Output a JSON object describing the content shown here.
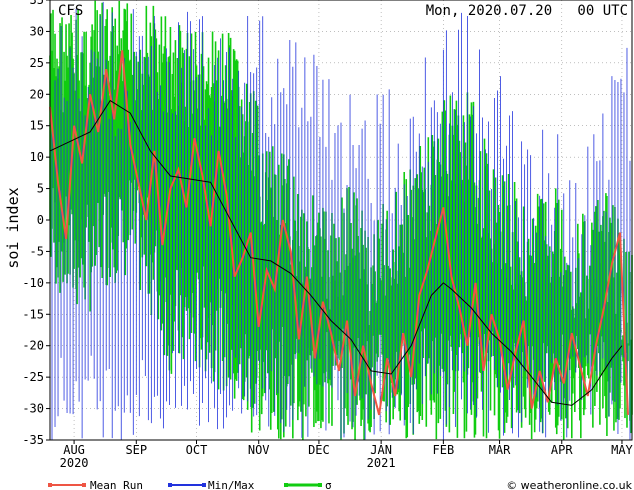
{
  "header": {
    "model": "CFS",
    "datetime": "Mon, 2020.07.20   00 UTC"
  },
  "credit": "© weatheronline.co.uk",
  "chart_data": {
    "type": "line",
    "title": "CFS",
    "ylabel": "soi index",
    "xlabel": "",
    "ylim": [
      -35,
      35
    ],
    "y_ticks": [
      -35,
      -30,
      -25,
      -20,
      -15,
      -10,
      -5,
      0,
      5,
      10,
      15,
      20,
      25,
      30,
      35
    ],
    "x_ticks": [
      {
        "label": "AUG",
        "sublabel": "2020",
        "day": 12
      },
      {
        "label": "SEP",
        "sublabel": "",
        "day": 43
      },
      {
        "label": "OCT",
        "sublabel": "",
        "day": 73
      },
      {
        "label": "NOV",
        "sublabel": "",
        "day": 104
      },
      {
        "label": "DEC",
        "sublabel": "",
        "day": 134
      },
      {
        "label": "JAN",
        "sublabel": "2021",
        "day": 165
      },
      {
        "label": "FEB",
        "sublabel": "",
        "day": 196
      },
      {
        "label": "MAR",
        "sublabel": "",
        "day": 224
      },
      {
        "label": "APR",
        "sublabel": "",
        "day": 255
      },
      {
        "label": "MAY",
        "sublabel": "",
        "day": 285
      }
    ],
    "xlim": [
      0,
      290
    ],
    "grid": true,
    "legend": {
      "placement": "bottom",
      "entries": [
        {
          "name": "Mean Run",
          "color": "#ee5544"
        },
        {
          "name": "Min/Max",
          "color": "#2233dd"
        },
        {
          "name": "σ",
          "color": "#11cc11"
        }
      ]
    },
    "series": [
      {
        "name": "Mean Run",
        "color": "#ee5544",
        "x": [
          0,
          4,
          8,
          12,
          16,
          20,
          24,
          28,
          32,
          36,
          40,
          44,
          48,
          52,
          56,
          60,
          64,
          68,
          72,
          76,
          80,
          84,
          88,
          92,
          96,
          100,
          104,
          108,
          112,
          116,
          120,
          124,
          128,
          132,
          136,
          140,
          144,
          148,
          152,
          156,
          160,
          164,
          168,
          172,
          176,
          180,
          184,
          188,
          192,
          196,
          200,
          204,
          208,
          212,
          216,
          220,
          224,
          228,
          232,
          236,
          240,
          244,
          248,
          252,
          256,
          260,
          264,
          268,
          272,
          276,
          280,
          284,
          288
        ],
        "y": [
          18,
          6,
          -3,
          15,
          9,
          20,
          14,
          24,
          16,
          27,
          12,
          6,
          0,
          11,
          -4,
          5,
          8,
          2,
          13,
          7,
          -1,
          11,
          4,
          -9,
          -6,
          -2,
          -17,
          -8,
          -11,
          0,
          -5,
          -19,
          -9,
          -22,
          -13,
          -18,
          -24,
          -16,
          -28,
          -20,
          -26,
          -31,
          -22,
          -28,
          -18,
          -25,
          -12,
          -8,
          -3,
          2,
          -9,
          -14,
          -20,
          -10,
          -24,
          -15,
          -19,
          -27,
          -21,
          -16,
          -30,
          -24,
          -29,
          -22,
          -26,
          -18,
          -23,
          -28,
          -20,
          -14,
          -7,
          -2,
          -31
        ]
      },
      {
        "name": "",
        "color": "#000000",
        "x": [
          0,
          10,
          20,
          30,
          40,
          50,
          60,
          70,
          80,
          90,
          100,
          110,
          120,
          130,
          140,
          150,
          160,
          170,
          180,
          190,
          196,
          200,
          210,
          220,
          230,
          240,
          250,
          260,
          270,
          280,
          285
        ],
        "y": [
          11,
          12.5,
          14,
          19,
          17,
          11,
          7,
          6.5,
          6,
          0,
          -6,
          -6.5,
          -8.5,
          -12,
          -16,
          -19,
          -24,
          -24.5,
          -20,
          -12,
          -10,
          -11,
          -14,
          -18,
          -21,
          -25,
          -29,
          -29.5,
          -27,
          -22,
          -20
        ]
      }
    ],
    "envelope": {
      "name": "σ",
      "color": "#11cc11",
      "x": [
        0,
        10,
        20,
        30,
        40,
        50,
        60,
        70,
        80,
        90,
        100,
        110,
        120,
        130,
        140,
        150,
        160,
        170,
        180,
        190,
        200,
        210,
        220,
        230,
        240,
        250,
        260,
        270,
        280,
        288
      ],
      "upper": [
        35,
        34,
        35,
        35,
        35,
        35,
        33,
        32,
        30,
        30,
        22,
        12,
        10,
        5,
        2,
        8,
        0,
        5,
        10,
        15,
        22,
        20,
        10,
        7,
        3,
        8,
        0,
        3,
        5,
        -5
      ],
      "lower": [
        -10,
        -15,
        -15,
        -10,
        -10,
        -15,
        -25,
        -25,
        -25,
        -30,
        -35,
        -35,
        -35,
        -35,
        -35,
        -35,
        -35,
        -35,
        -35,
        -35,
        -35,
        -35,
        -35,
        -35,
        -35,
        -35,
        -35,
        -35,
        -35,
        -35
      ]
    },
    "minmax": {
      "name": "Min/Max",
      "color": "#2233dd",
      "x": [
        0,
        10,
        20,
        30,
        40,
        50,
        60,
        70,
        80,
        90,
        100,
        110,
        120,
        130,
        140,
        150,
        160,
        170,
        180,
        190,
        200,
        210,
        220,
        230,
        240,
        250,
        260,
        270,
        280,
        288
      ],
      "max": [
        35,
        35,
        35,
        35,
        35,
        35,
        35,
        35,
        35,
        35,
        35,
        35,
        32,
        28,
        25,
        23,
        20,
        22,
        25,
        30,
        35,
        33,
        25,
        22,
        18,
        15,
        12,
        15,
        25,
        30
      ],
      "min": [
        -35,
        -35,
        -35,
        -35,
        -35,
        -35,
        -35,
        -35,
        -35,
        -35,
        -35,
        -35,
        -35,
        -35,
        -35,
        -35,
        -35,
        -35,
        -35,
        -35,
        -35,
        -35,
        -35,
        -35,
        -35,
        -35,
        -35,
        -35,
        -35,
        -35
      ]
    }
  }
}
